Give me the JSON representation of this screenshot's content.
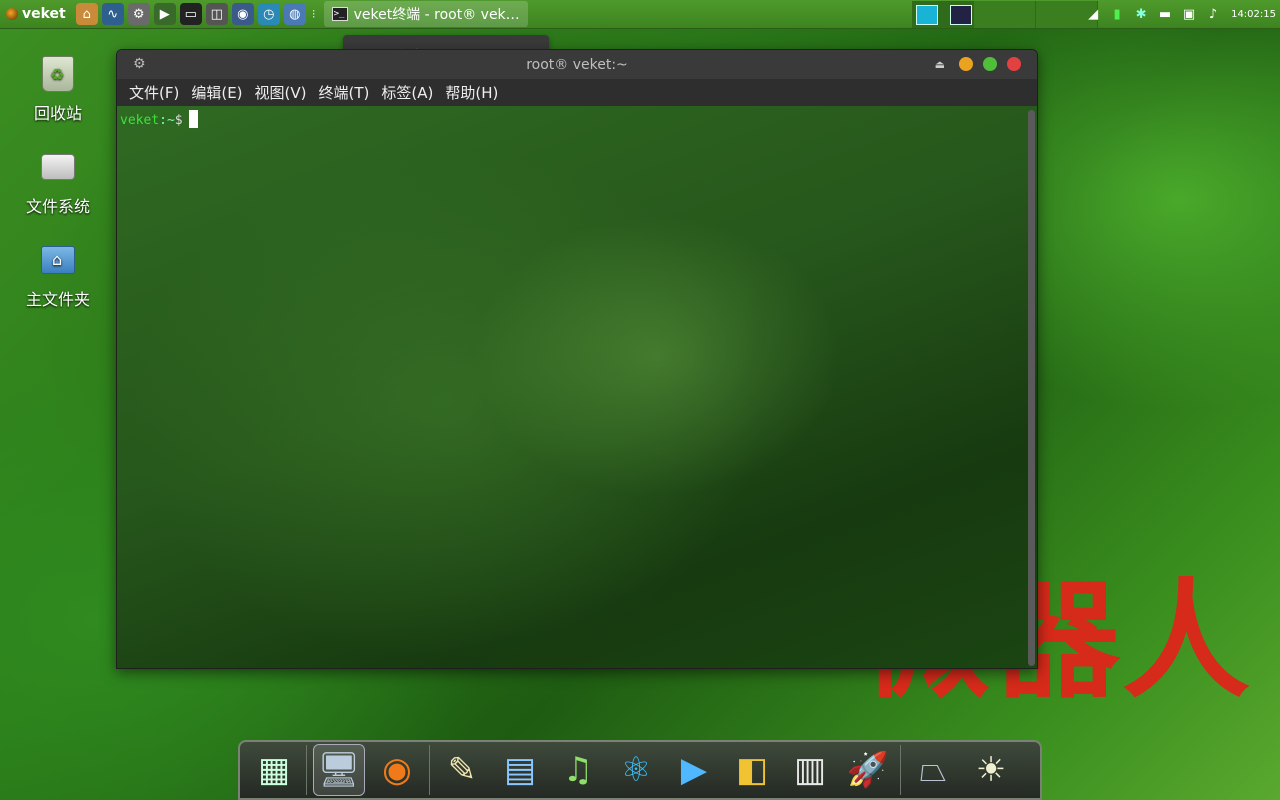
{
  "top_panel": {
    "menu_label": "veket",
    "task_title": "veket终端 - root@ veket:~",
    "task_title_short": "veket终端 - root® vek…",
    "clock": "14:02:15"
  },
  "tooltip": "veket终端 - root® veket:~",
  "desktop_icons": [
    {
      "label": "回收站",
      "icon": "trash-icon"
    },
    {
      "label": "文件系统",
      "icon": "drive-icon"
    },
    {
      "label": "主文件夹",
      "icon": "home-folder-icon"
    }
  ],
  "terminal": {
    "title": "root® veket:~",
    "menu": [
      "文件(F)",
      "编辑(E)",
      "视图(V)",
      "终端(T)",
      "标签(A)",
      "帮助(H)"
    ],
    "prompt_host": "veket",
    "prompt_path": ":~",
    "prompt_symbol": "$"
  },
  "watermark": "微器人",
  "colors": {
    "panel": "#4f9a2c",
    "prompt": "#3ee03e",
    "watermark": "#d62a1a"
  }
}
